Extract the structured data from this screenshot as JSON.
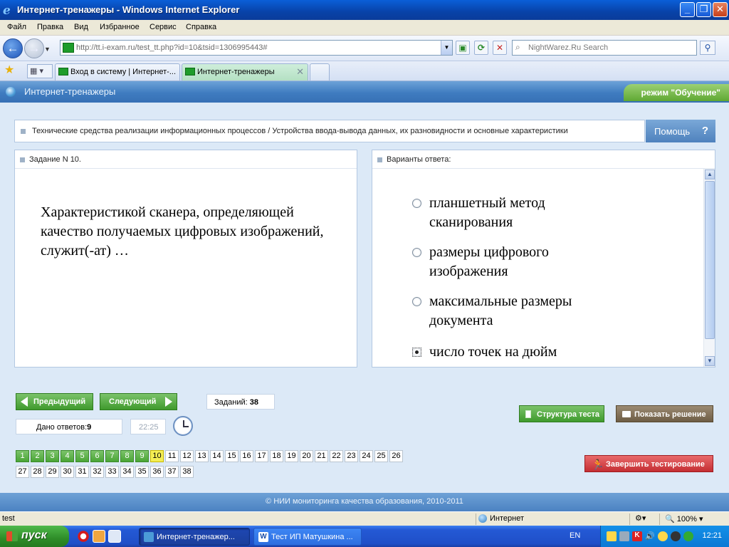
{
  "window": {
    "title": "Интернет-тренажеры - Windows Internet Explorer"
  },
  "menu": [
    "Файл",
    "Правка",
    "Вид",
    "Избранное",
    "Сервис",
    "Справка"
  ],
  "address": {
    "url": "http://tt.i-exam.ru/test_tt.php?id=10&tsid=1306995443#"
  },
  "search": {
    "placeholder": "NightWarez.Ru Search"
  },
  "tabs": [
    {
      "label": "Вход в систему | Интернет-...",
      "active": false
    },
    {
      "label": "Интернет-тренажеры",
      "active": true
    }
  ],
  "app": {
    "title": "Интернет-тренажеры",
    "mode": "режим \"Обучение\"",
    "breadcrumb": "Технические средства реализации информационных процессов / Устройства ввода-вывода данных, их разновидности и основные характеристики",
    "help": "Помощь",
    "help_icon": "?",
    "question_header": "Задание N 10.",
    "question": "Характеристикой сканера, определяющей качество получаемых цифровых изображений, служит(-ат) …",
    "answers_header": "Варианты ответа:",
    "answers": [
      {
        "text": "планшетный метод сканирования",
        "selected": false
      },
      {
        "text": "размеры цифрового изображения",
        "selected": false
      },
      {
        "text": "максимальные размеры документа",
        "selected": false
      },
      {
        "text": "число точек на дюйм",
        "selected": true
      }
    ],
    "prev": "Предыдущий",
    "next": "Следующий",
    "tasks_label": "Заданий:",
    "tasks_total": "38",
    "answered_label": "Дано ответов:",
    "answered_count": "9",
    "timer": "22:25",
    "structure": "Структура теста",
    "solution": "Показать решение",
    "finish": "Завершить тестирование",
    "current_task": 10,
    "answered_tasks": [
      1,
      2,
      3,
      4,
      5,
      6,
      7,
      8,
      9
    ],
    "footer": "© НИИ мониторинга качества образования, 2010-2011"
  },
  "status": {
    "text": "test",
    "zone": "Интернет",
    "zoom": "100%"
  },
  "taskbar": {
    "start": "пуск",
    "tasks": [
      "Интернет-тренажер...",
      "Тест ИП Матушкина ..."
    ],
    "lang": "EN",
    "clock": "12:21"
  },
  "colors": {
    "accent_green": "#4aa536",
    "current_yellow": "#f4ee55",
    "header_blue": "#3f7cc0"
  }
}
